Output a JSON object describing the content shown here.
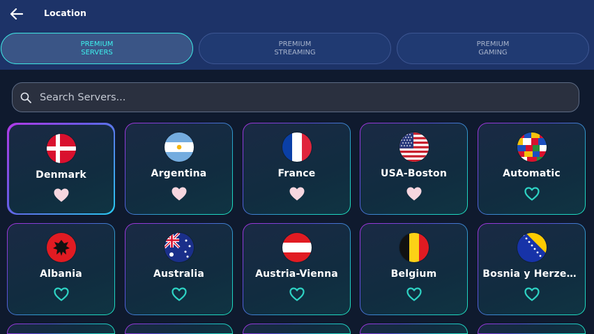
{
  "header": {
    "title": "Location",
    "back_icon": "arrow-left-icon"
  },
  "tabs": [
    {
      "label": "PREMIUM\nSERVERS",
      "active": true
    },
    {
      "label": "PREMIUM\nSTREAMING",
      "active": false
    },
    {
      "label": "PREMIUM\nGAMING",
      "active": false
    }
  ],
  "search": {
    "placeholder": "Search Servers...",
    "value": ""
  },
  "servers": [
    {
      "name": "Denmark",
      "flag": "denmark-flag",
      "favorite": true,
      "selected": true
    },
    {
      "name": "Argentina",
      "flag": "argentina-flag",
      "favorite": true,
      "selected": false
    },
    {
      "name": "France",
      "flag": "france-flag",
      "favorite": true,
      "selected": false
    },
    {
      "name": "USA-Boston",
      "flag": "usa-flag",
      "favorite": true,
      "selected": false
    },
    {
      "name": "Automatic",
      "flag": "world-flags-icon",
      "favorite": false,
      "selected": false
    },
    {
      "name": "Albania",
      "flag": "albania-flag",
      "favorite": false,
      "selected": false
    },
    {
      "name": "Australia",
      "flag": "australia-flag",
      "favorite": false,
      "selected": false
    },
    {
      "name": "Austria-Vienna",
      "flag": "austria-flag",
      "favorite": false,
      "selected": false
    },
    {
      "name": "Belgium",
      "flag": "belgium-flag",
      "favorite": false,
      "selected": false
    },
    {
      "name": "Bosnia y Herzeg…",
      "flag": "bosnia-flag",
      "favorite": false,
      "selected": false
    }
  ],
  "colors": {
    "accent": "#3ef2ee",
    "heart_filled": "#f6d6df",
    "heart_outline": "#2ed3c4",
    "header_bg": "#1d3368",
    "page_bg": "#0f1a2e"
  }
}
